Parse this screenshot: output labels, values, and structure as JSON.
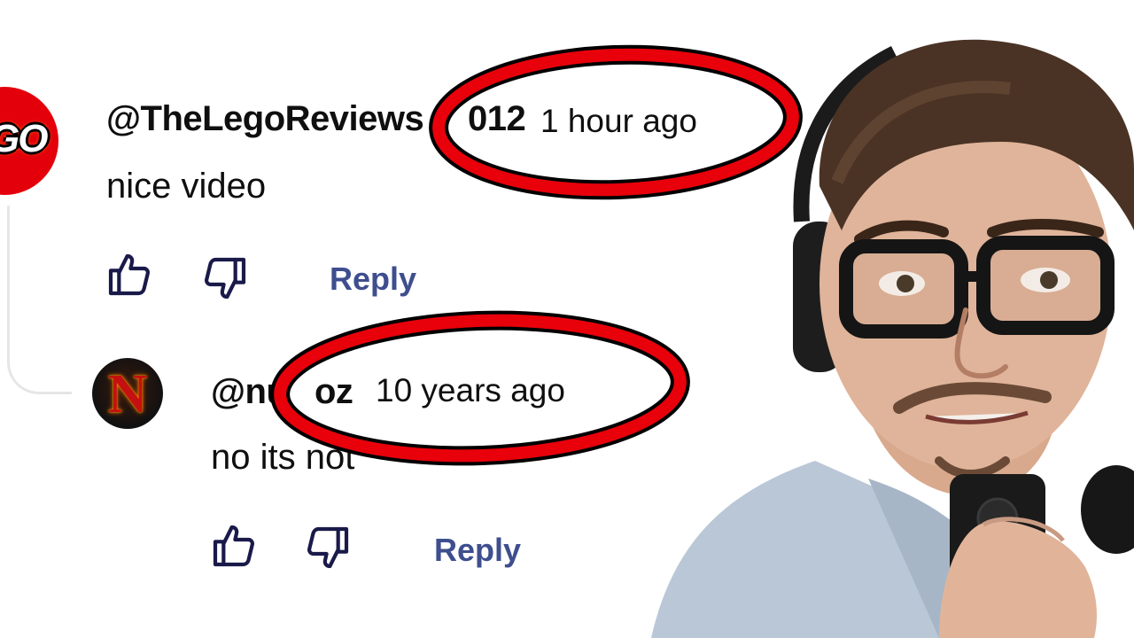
{
  "comments": [
    {
      "author": "@TheLegoReviews",
      "author_suffix": "012",
      "time": "1 hour ago",
      "text": "nice video",
      "avatar_text": "GO",
      "reply_label": "Reply"
    },
    {
      "author_prefix": "@nu",
      "author_suffix": "oz",
      "time": "10 years ago",
      "text_before": "no its no",
      "text_after": "t",
      "avatar_letter": "N",
      "reply_label": "Reply"
    }
  ],
  "icons": {
    "like": "thumbs-up-icon",
    "dislike": "thumbs-down-icon"
  },
  "colors": {
    "highlight_ring": "#e8000a",
    "ring_outline": "#000000",
    "reply": "#3e4e8e",
    "lego_red": "#e3000b"
  }
}
